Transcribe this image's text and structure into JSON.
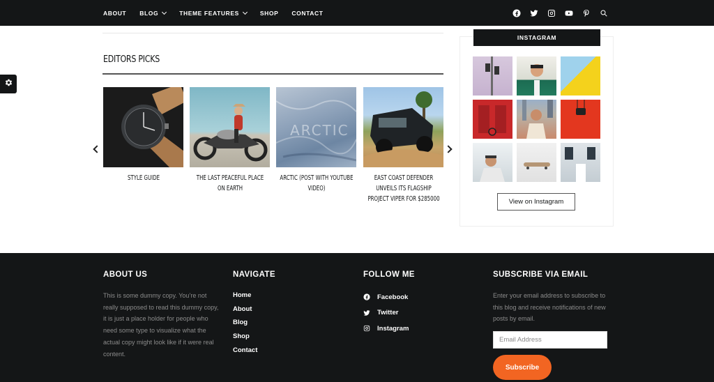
{
  "nav": {
    "items": [
      {
        "label": "ABOUT",
        "has_dropdown": false
      },
      {
        "label": "BLOG",
        "has_dropdown": true
      },
      {
        "label": "THEME FEATURES",
        "has_dropdown": true
      },
      {
        "label": "SHOP",
        "has_dropdown": false
      },
      {
        "label": "CONTACT",
        "has_dropdown": false
      }
    ],
    "social_icons": [
      "facebook-icon",
      "twitter-icon",
      "instagram-icon",
      "youtube-icon",
      "pinterest-icon",
      "search-icon"
    ]
  },
  "editors_picks": {
    "title": "EDITORS PICKS",
    "items": [
      {
        "title": "STYLE GUIDE",
        "image": "watch"
      },
      {
        "title": "THE LAST PEACEFUL PLACE ON EARTH",
        "image": "motorcycle"
      },
      {
        "title": "ARCTIC (POST WITH YOUTUBE VIDEO)",
        "image": "arctic"
      },
      {
        "title": "EAST COAST DEFENDER UNVEILS ITS FLAGSHIP PROJECT VIPER FOR $285000",
        "image": "truck"
      }
    ]
  },
  "instagram": {
    "title": "INSTAGRAM",
    "button_label": "View on Instagram",
    "photos": 9
  },
  "footer": {
    "about": {
      "title": "ABOUT US",
      "text": "This is some dummy copy. You’re not really supposed to read this dummy copy, it is just a place holder for people who need some type to visualize what the actual copy might look like if it were real content."
    },
    "navigate": {
      "title": "NAVIGATE",
      "links": [
        "Home",
        "About",
        "Blog",
        "Shop",
        "Contact"
      ]
    },
    "follow": {
      "title": "FOLLOW ME",
      "links": [
        {
          "label": "Facebook",
          "icon": "facebook-icon"
        },
        {
          "label": "Twitter",
          "icon": "twitter-icon"
        },
        {
          "label": "Instagram",
          "icon": "instagram-icon"
        }
      ]
    },
    "subscribe": {
      "title": "SUBSCRIBE VIA EMAIL",
      "text": "Enter your email address to subscribe to this blog and receive notifications of new posts by email.",
      "placeholder": "Email Address",
      "button_label": "Subscribe"
    }
  },
  "colors": {
    "dark": "#141617",
    "accent": "#f26522",
    "muted_text": "#8c8c8c"
  }
}
